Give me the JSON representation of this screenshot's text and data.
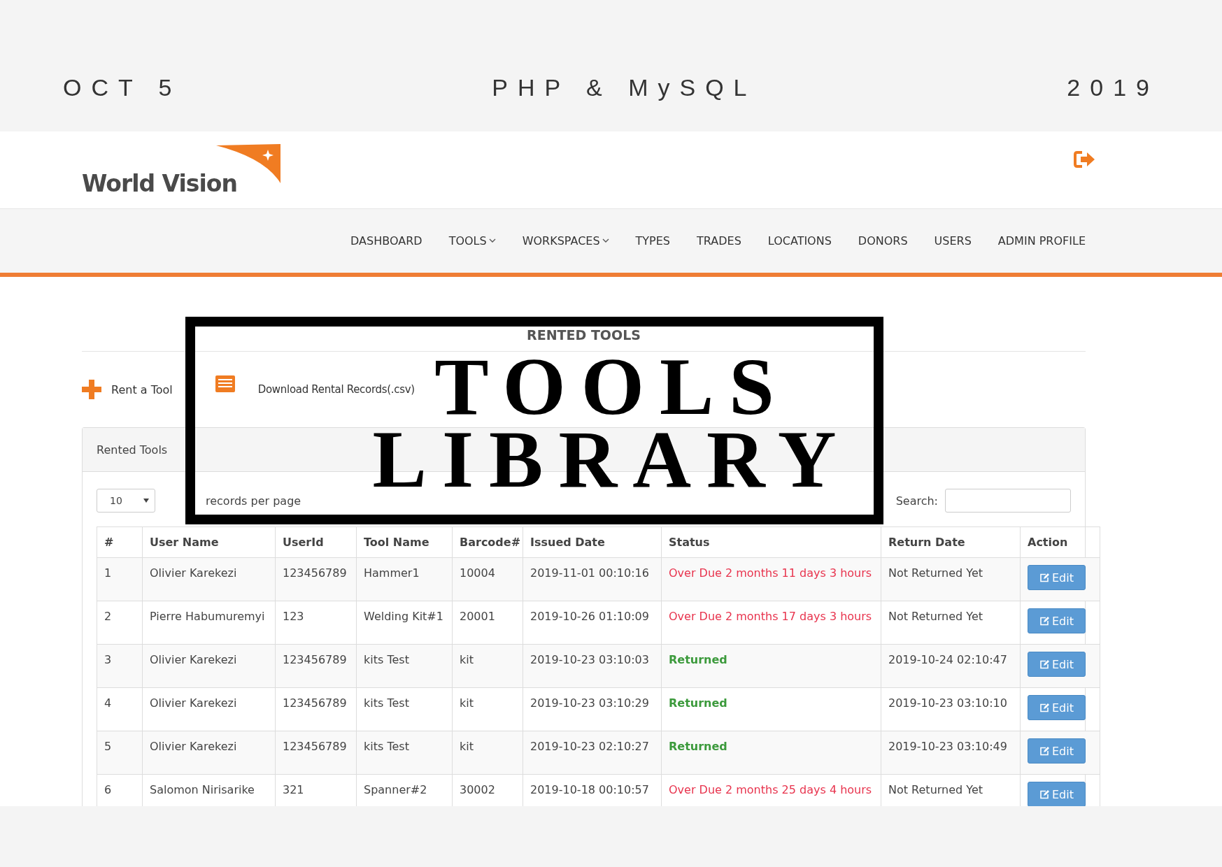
{
  "banner": {
    "date": "OCT 5",
    "title": "PHP & MySQL",
    "year": "2019"
  },
  "brand": {
    "name": "World Vision"
  },
  "nav": [
    {
      "label": "DASHBOARD",
      "dropdown": false
    },
    {
      "label": "TOOLS",
      "dropdown": true
    },
    {
      "label": "WORKSPACES",
      "dropdown": true
    },
    {
      "label": "TYPES",
      "dropdown": false
    },
    {
      "label": "TRADES",
      "dropdown": false
    },
    {
      "label": "LOCATIONS",
      "dropdown": false
    },
    {
      "label": "DONORS",
      "dropdown": false
    },
    {
      "label": "USERS",
      "dropdown": false
    },
    {
      "label": "ADMIN PROFILE",
      "dropdown": false
    }
  ],
  "page_title": "RENTED TOOLS",
  "actions": [
    {
      "kind": "add",
      "label": "Rent a Tool"
    },
    {
      "kind": "download",
      "label": "Download Rental Records(.csv)"
    }
  ],
  "panel": {
    "title": "Rented Tools",
    "page_size": "10",
    "page_size_label": "records per page",
    "search_label": "Search:"
  },
  "table": {
    "columns": [
      "#",
      "User Name",
      "UserId",
      "Tool Name",
      "Barcode#",
      "Issued Date",
      "Status",
      "Return Date",
      "Action"
    ],
    "rows": [
      {
        "cells": [
          "1",
          "Olivier Karekezi",
          "123456789",
          "Hammer1",
          "10004",
          "2019-11-01 00:10:16"
        ],
        "status": {
          "kind": "overdue",
          "text": "Over Due 2 months 11 days 3 hours"
        },
        "return_date": "Not Returned Yet",
        "action": "Edit"
      },
      {
        "cells": [
          "2",
          "Pierre Habumuremyi",
          "123",
          "Welding Kit#1",
          "20001",
          "2019-10-26 01:10:09"
        ],
        "status": {
          "kind": "overdue",
          "text": "Over Due 2 months 17 days 3 hours"
        },
        "return_date": "Not Returned Yet",
        "action": "Edit"
      },
      {
        "cells": [
          "3",
          "Olivier Karekezi",
          "123456789",
          "kits Test",
          "kit",
          "2019-10-23 03:10:03"
        ],
        "status": {
          "kind": "returned",
          "text": "Returned"
        },
        "return_date": "2019-10-24 02:10:47",
        "action": "Edit"
      },
      {
        "cells": [
          "4",
          "Olivier Karekezi",
          "123456789",
          "kits Test",
          "kit",
          "2019-10-23 03:10:29"
        ],
        "status": {
          "kind": "returned",
          "text": "Returned"
        },
        "return_date": "2019-10-23 03:10:10",
        "action": "Edit"
      },
      {
        "cells": [
          "5",
          "Olivier Karekezi",
          "123456789",
          "kits Test",
          "kit",
          "2019-10-23 02:10:27"
        ],
        "status": {
          "kind": "returned",
          "text": "Returned"
        },
        "return_date": "2019-10-23 03:10:49",
        "action": "Edit"
      },
      {
        "cells": [
          "6",
          "Salomon Nirisarike",
          "321",
          "Spanner#2",
          "30002",
          "2019-10-18 00:10:57"
        ],
        "status": {
          "kind": "overdue",
          "text": "Over Due 2 months 25 days 4 hours"
        },
        "return_date": "Not Returned Yet",
        "action": "Edit"
      }
    ]
  },
  "overlay": {
    "lines": [
      "TOOLS",
      "LIBRARY"
    ]
  }
}
